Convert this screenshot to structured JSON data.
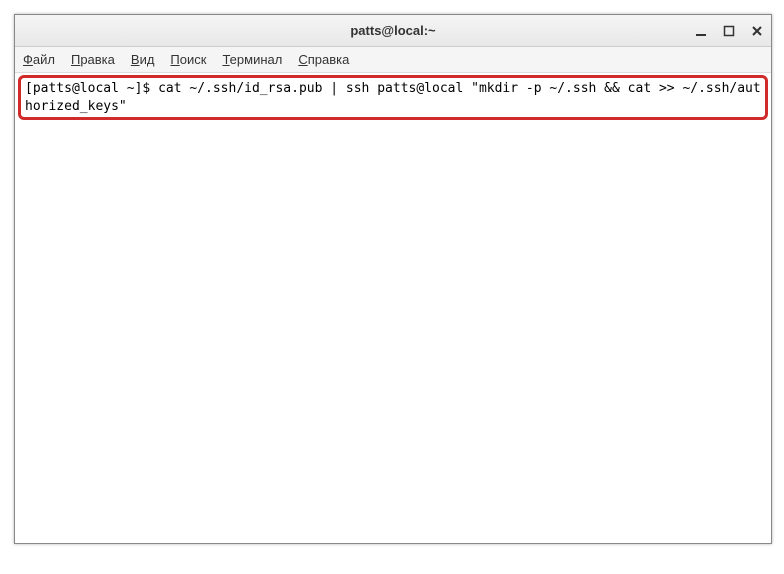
{
  "titlebar": {
    "title": "patts@local:~"
  },
  "menubar": {
    "items": [
      {
        "prefix": "Ф",
        "rest": "айл"
      },
      {
        "prefix": "П",
        "rest": "равка"
      },
      {
        "prefix": "В",
        "rest": "ид"
      },
      {
        "prefix": "П",
        "rest": "оиск"
      },
      {
        "prefix": "Т",
        "rest": "ерминал"
      },
      {
        "prefix": "С",
        "rest": "правка"
      }
    ]
  },
  "terminal": {
    "prompt": "[patts@local ~]$ ",
    "command": "cat ~/.ssh/id_rsa.pub | ssh patts@local \"mkdir -p ~/.ssh && cat >> ~/.ssh/authorized_keys\""
  }
}
